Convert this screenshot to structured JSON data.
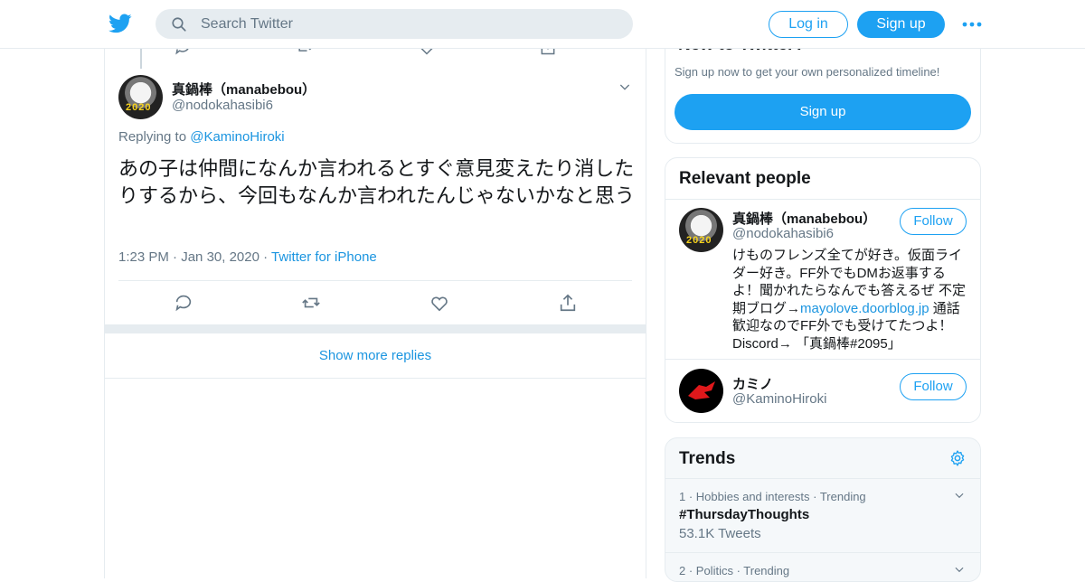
{
  "colors": {
    "accent": "#1da1f2",
    "link": "#1b95e0",
    "muted": "#657786"
  },
  "topbar": {
    "search_placeholder": "Search Twitter",
    "login_label": "Log in",
    "signup_label": "Sign up"
  },
  "tweet": {
    "display_name": "真鍋棒（manabebou）",
    "handle": "@nodokahasibi6",
    "replying_prefix": "Replying to",
    "replying_to": "@KaminoHiroki",
    "text": "あの子は仲間になんか言われるとすぐ意見変えたり消したりするから、今回もなんか言われたんじゃないかなと思う",
    "time": "1:23 PM",
    "date": "Jan 30, 2020",
    "source": "Twitter for iPhone"
  },
  "show_more_label": "Show more replies",
  "new_to_twitter": {
    "title": "New to Twitter?",
    "subtitle": "Sign up now to get your own personalized timeline!",
    "button": "Sign up"
  },
  "relevant_people": {
    "title": "Relevant people",
    "people": [
      {
        "name": "真鍋棒（manabebou）",
        "handle": "@nodokahasibi6",
        "follow": "Follow",
        "bio_1": "けものフレンズ全てが好き。仮面ライダー好き。FF外でもDMお返事するよ！聞かれたらなんでも答えるぜ 不定期ブログ→",
        "bio_link": "mayolove.doorblog.jp",
        "bio_2": " 通話歓迎なのでFF外でも受けてたつよ！Discord→ 「真鍋棒#2095」"
      },
      {
        "name": "カミノ",
        "handle": "@KaminoHiroki",
        "follow": "Follow"
      }
    ]
  },
  "trends": {
    "title": "Trends",
    "items": [
      {
        "meta": "1 · Hobbies and interests · Trending",
        "name": "#ThursdayThoughts",
        "count": "53.1K Tweets"
      },
      {
        "meta": "2 · Politics · Trending"
      }
    ]
  },
  "icons": [
    "twitter-bird-icon",
    "search-icon",
    "more-dots-icon",
    "reply-icon",
    "retweet-icon",
    "like-icon",
    "share-icon",
    "chevron-down-icon",
    "gear-icon"
  ]
}
